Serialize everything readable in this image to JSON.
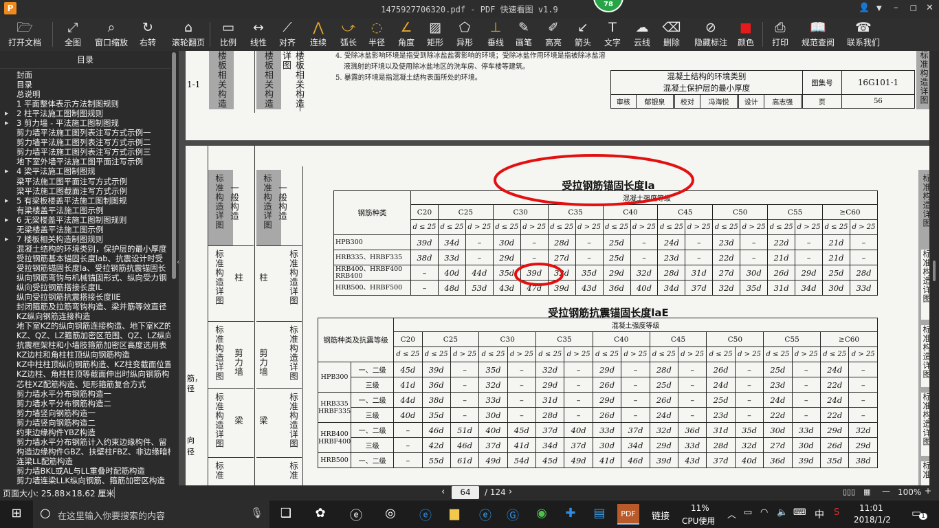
{
  "window": {
    "title": "1475927706320.pdf - PDF 快速看图 v1.9",
    "logo": "P",
    "badge": "78"
  },
  "toolbar": [
    {
      "label": "打开文档",
      "icon": "folder-icon"
    },
    {
      "label": "全图",
      "icon": "fullscreen-icon"
    },
    {
      "label": "窗口缩放",
      "icon": "magnifier-icon"
    },
    {
      "label": "右转",
      "icon": "rotate-icon"
    },
    {
      "label": "滚轮翻页",
      "icon": "mouse-icon"
    },
    {
      "label": "比例",
      "icon": "ruler-icon"
    },
    {
      "label": "线性",
      "icon": "linear-measure-icon"
    },
    {
      "label": "对齐",
      "icon": "align-measure-icon"
    },
    {
      "label": "连续",
      "icon": "continuous-measure-icon"
    },
    {
      "label": "弧长",
      "icon": "arc-length-icon"
    },
    {
      "label": "半径",
      "icon": "radius-icon"
    },
    {
      "label": "角度",
      "icon": "angle-icon"
    },
    {
      "label": "矩形",
      "icon": "rectangle-icon"
    },
    {
      "label": "异形",
      "icon": "polygon-icon"
    },
    {
      "label": "垂线",
      "icon": "perpendicular-icon"
    },
    {
      "label": "画笔",
      "icon": "pen-icon"
    },
    {
      "label": "高亮",
      "icon": "highlighter-icon"
    },
    {
      "label": "箭头",
      "icon": "arrow-icon"
    },
    {
      "label": "文字",
      "icon": "text-icon"
    },
    {
      "label": "云线",
      "icon": "cloud-icon"
    },
    {
      "label": "删除",
      "icon": "eraser-icon"
    },
    {
      "label": "隐藏标注",
      "icon": "hide-eye-icon"
    },
    {
      "label": "颜色",
      "icon": "color-icon"
    },
    {
      "label": "打印",
      "icon": "printer-icon"
    },
    {
      "label": "规范查阅",
      "icon": "book-icon"
    },
    {
      "label": "联系我们",
      "icon": "support-icon"
    }
  ],
  "sidebar": {
    "header": "目录",
    "items": [
      {
        "t": "封面",
        "a": false
      },
      {
        "t": "目录",
        "a": false
      },
      {
        "t": "总说明",
        "a": false
      },
      {
        "t": "1 平面整体表示方法制图规则",
        "a": false
      },
      {
        "t": "2 柱平法施工图制图规则",
        "a": true
      },
      {
        "t": "3 剪力墙 - 平法施工图制图规",
        "a": true
      },
      {
        "t": "剪力墙平法施工图列表注写方式示例一",
        "a": false
      },
      {
        "t": "剪力墙平法施工图列表注写方式示例二",
        "a": false
      },
      {
        "t": "剪力墙平法施工图列表注写方式示例三",
        "a": false
      },
      {
        "t": "地下室外墙平法施工图平面注写示例",
        "a": false
      },
      {
        "t": "4 梁平法施工图制图规",
        "a": true
      },
      {
        "t": "梁平法施工图平面注写方式示例",
        "a": false
      },
      {
        "t": "梁平法施工图截面注写方式示例",
        "a": false
      },
      {
        "t": "5 有梁板楼盖平法施工图制图规",
        "a": true
      },
      {
        "t": "有梁楼盖平法施工图示例",
        "a": false
      },
      {
        "t": "6 无梁楼盖平法施工图制图规则",
        "a": true
      },
      {
        "t": "无梁楼盖平法施工图示例",
        "a": false
      },
      {
        "t": "7 楼板相关构造制图规则",
        "a": true
      },
      {
        "t": "混凝土结构的环境类别，保护层的最小厚度",
        "a": false
      },
      {
        "t": "受拉钢筋基本锚固长度lab、抗震设计时受",
        "a": false
      },
      {
        "t": "受拉钢筋锚固长度la、受拉钢筋抗震锚固长",
        "a": false
      },
      {
        "t": "纵向钢筋弯钩与机械锚固形式、纵向受力钢",
        "a": false
      },
      {
        "t": "纵向受拉钢筋搭接长度lL",
        "a": false
      },
      {
        "t": "纵向受拉钢筋抗震搭接长度llE",
        "a": false
      },
      {
        "t": "封闭箍筋及拉筋弯钩构造、梁并筋等效直径",
        "a": false
      },
      {
        "t": "KZ纵向钢筋连接构造",
        "a": false
      },
      {
        "t": "地下室KZ的纵向钢筋连接构造、地下室KZ的",
        "a": false
      },
      {
        "t": "KZ、QZ、LZ箍筋加密区范围、QZ、LZ纵向钢",
        "a": false
      },
      {
        "t": "抗震框架柱和小墙肢箍筋加密区高度选用表",
        "a": false
      },
      {
        "t": "KZ边柱和角柱柱顶纵向钢筋构造",
        "a": false
      },
      {
        "t": "KZ中柱柱顶纵向钢筋构造、KZ柱变截面位置",
        "a": false
      },
      {
        "t": "KZ边柱、角柱柱顶等截面伸出时纵向钢筋构",
        "a": false
      },
      {
        "t": "芯柱XZ配筋构造、矩形箍筋复合方式",
        "a": false
      },
      {
        "t": "剪力墙水平分布钢筋构造一",
        "a": false
      },
      {
        "t": "剪力墙水平分布钢筋构造二",
        "a": false
      },
      {
        "t": "剪力墙竖向钢筋构造一",
        "a": false
      },
      {
        "t": "剪力墙竖向钢筋构造二",
        "a": false
      },
      {
        "t": "约束边缘构件YBZ构造",
        "a": false
      },
      {
        "t": "剪力墙水平分布钢筋计入约束边缘构件、留",
        "a": false
      },
      {
        "t": "构造边缘构件GBZ、扶壁柱FBZ、非边缘暗柱",
        "a": false
      },
      {
        "t": "连梁LL配筋构造",
        "a": false
      },
      {
        "t": "剪力墙BKL或AL与LL重叠时配筋构造",
        "a": false
      },
      {
        "t": "剪力墙连梁LLK纵向钢筋、箍筋加密区构造",
        "a": false
      }
    ]
  },
  "page_top": {
    "note4": "4. 受除冰盐影响环境是指受到除冰盐盐雾影响的环境；受除冰盐作用环境是指被除冰盐溶",
    "note4b": "液溅射的环境以及使用除冰盐地区的洗车房、停车楼等建筑。",
    "note5": "5. 暴露的环境是指混凝土结构表面所处的环境。",
    "tb_title1": "混凝土结构的环境类别",
    "tb_title2": "混凝土保护层的最小厚度",
    "tb_setno_label": "图集号",
    "tb_setno": "16G101-1",
    "tb_row2": [
      "审核",
      "郁银泉",
      "",
      "校对",
      "冯海悦",
      "",
      "设计",
      "高志强",
      "",
      "页",
      "56"
    ],
    "left_frag": "1-1",
    "side_a": "楼板相关构造",
    "side_b": "楼板相关构造详图",
    "side_c": "标准构造详图"
  },
  "page_main": {
    "sidecol": [
      {
        "g": "一般构造",
        "t": "标准构造详图"
      },
      {
        "g": "柱",
        "t": "标准构造详图"
      },
      {
        "g": "剪力墙",
        "t": "标准构造详图"
      },
      {
        "g": "梁",
        "t": "标准构造详图"
      },
      {
        "g": "",
        "t": "标准"
      }
    ],
    "left_frag": [
      "筋，",
      "径",
      "向",
      "径"
    ],
    "t1_title": "受拉钢筋锚固长度la",
    "t1_sub": "混凝土强度等级",
    "t1_typehdr": "钢筋种类",
    "grades": [
      "C20",
      "C25",
      "C30",
      "C35",
      "C40",
      "C45",
      "C50",
      "C55",
      "≥C60"
    ],
    "dle": "d ≤ 25",
    "dgt": "d > 25",
    "t1_rows": [
      {
        "name": "HPB300",
        "v": [
          "39d",
          "34d",
          "–",
          "30d",
          "–",
          "28d",
          "–",
          "25d",
          "–",
          "24d",
          "–",
          "23d",
          "–",
          "22d",
          "–",
          "21d",
          "–"
        ]
      },
      {
        "name": "HRB335、HRBF335",
        "v": [
          "38d",
          "33d",
          "–",
          "29d",
          "–",
          "27d",
          "–",
          "25d",
          "–",
          "23d",
          "–",
          "22d",
          "–",
          "21d",
          "–",
          "21d",
          "–"
        ]
      },
      {
        "name": "HRB400、HRBF400 RRB400",
        "v": [
          "–",
          "40d",
          "44d",
          "35d",
          "39d",
          "32d",
          "35d",
          "29d",
          "32d",
          "28d",
          "31d",
          "27d",
          "30d",
          "26d",
          "29d",
          "25d",
          "28d"
        ]
      },
      {
        "name": "HRB500、HRBF500",
        "v": [
          "–",
          "48d",
          "53d",
          "43d",
          "47d",
          "39d",
          "43d",
          "36d",
          "40d",
          "34d",
          "37d",
          "32d",
          "35d",
          "31d",
          "34d",
          "30d",
          "33d"
        ]
      }
    ],
    "t2_title": "受拉钢筋抗震锚固长度laE",
    "t2_sub": "混凝土强度等级",
    "t2_typehdr": "钢筋种类及抗震等级",
    "t2_rows": [
      {
        "name": "HPB300",
        "lv": "一、二级",
        "v": [
          "45d",
          "39d",
          "–",
          "35d",
          "–",
          "32d",
          "–",
          "29d",
          "–",
          "28d",
          "–",
          "26d",
          "–",
          "25d",
          "–",
          "24d",
          "–"
        ]
      },
      {
        "name": "",
        "lv": "三级",
        "v": [
          "41d",
          "36d",
          "–",
          "32d",
          "–",
          "29d",
          "–",
          "26d",
          "–",
          "25d",
          "–",
          "24d",
          "–",
          "23d",
          "–",
          "22d",
          "–"
        ]
      },
      {
        "name": "HRB335 HRBF335",
        "lv": "一、二级",
        "v": [
          "44d",
          "38d",
          "–",
          "33d",
          "–",
          "31d",
          "–",
          "29d",
          "–",
          "26d",
          "–",
          "25d",
          "–",
          "24d",
          "–",
          "24d",
          "–"
        ]
      },
      {
        "name": "",
        "lv": "三级",
        "v": [
          "40d",
          "35d",
          "–",
          "30d",
          "–",
          "28d",
          "–",
          "26d",
          "–",
          "24d",
          "–",
          "23d",
          "–",
          "22d",
          "–",
          "22d",
          "–"
        ]
      },
      {
        "name": "HRB400 HRBF400",
        "lv": "一、二级",
        "v": [
          "–",
          "46d",
          "51d",
          "40d",
          "45d",
          "37d",
          "40d",
          "33d",
          "37d",
          "32d",
          "36d",
          "31d",
          "35d",
          "30d",
          "33d",
          "29d",
          "32d"
        ]
      },
      {
        "name": "",
        "lv": "三级",
        "v": [
          "–",
          "42d",
          "46d",
          "37d",
          "41d",
          "34d",
          "37d",
          "30d",
          "34d",
          "29d",
          "33d",
          "28d",
          "32d",
          "27d",
          "30d",
          "26d",
          "29d"
        ]
      },
      {
        "name": "HRB500",
        "lv": "一、二级",
        "v": [
          "–",
          "55d",
          "61d",
          "49d",
          "54d",
          "45d",
          "49d",
          "41d",
          "46d",
          "39d",
          "43d",
          "37d",
          "40d",
          "36d",
          "39d",
          "35d",
          "38d"
        ]
      }
    ]
  },
  "status": {
    "page_size": "页面大小: 25.88×18.62 厘米",
    "page_current": "64",
    "page_total": "/ 124",
    "zoom": "100%"
  },
  "taskbar": {
    "search_placeholder": "在这里输入你要搜索的内容",
    "link": "链接",
    "cpu_pct": "11%",
    "cpu_label": "CPU使用",
    "ime": "中",
    "time": "11:01",
    "date": "2018/1/2",
    "notif": "1"
  }
}
